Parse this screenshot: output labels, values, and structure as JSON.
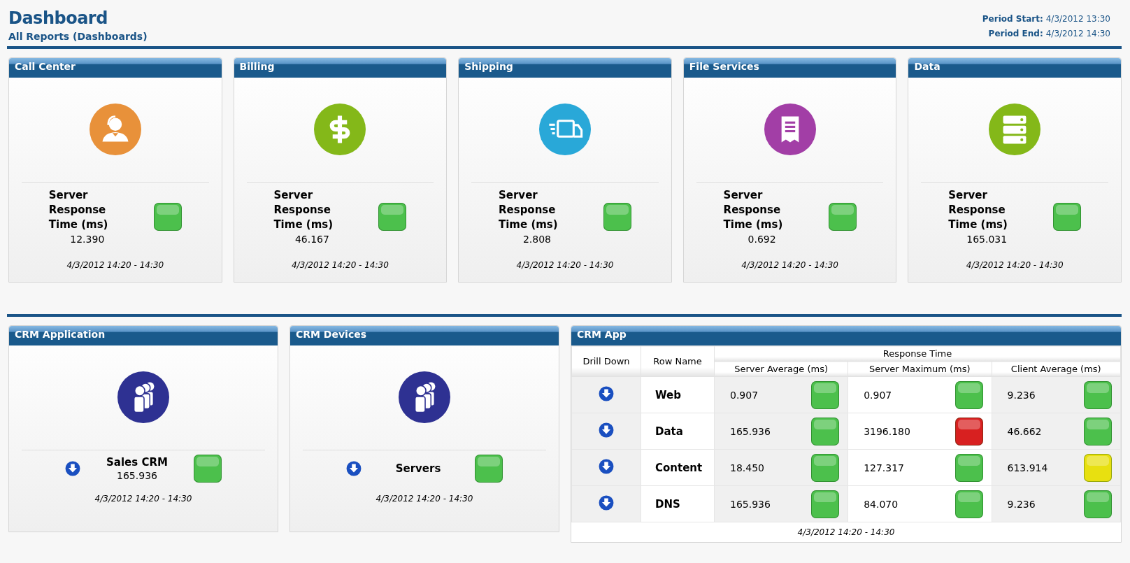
{
  "header": {
    "title": "Dashboard",
    "subtitle": "All Reports (Dashboards)",
    "period": [
      {
        "label": "Period Start:",
        "value": "4/3/2012 13:30"
      },
      {
        "label": "Period End:",
        "value": "4/3/2012 14:30"
      }
    ]
  },
  "top_cards": [
    {
      "title": "Call Center",
      "kind": "headset",
      "color": "#e8913a",
      "metric": "Server Response Time (ms)",
      "value": "12.390",
      "light": {
        "color": "#4cc04c"
      },
      "period": "4/3/2012 14:20 - 14:30"
    },
    {
      "title": "Billing",
      "kind": "dollar",
      "color": "#84b819",
      "metric": "Server Response Time (ms)",
      "value": "46.167",
      "light": {
        "color": "#4cc04c"
      },
      "period": "4/3/2012 14:20 - 14:30"
    },
    {
      "title": "Shipping",
      "kind": "truck",
      "color": "#29a8d8",
      "metric": "Server Response Time (ms)",
      "value": "2.808",
      "light": {
        "color": "#4cc04c"
      },
      "period": "4/3/2012 14:20 - 14:30"
    },
    {
      "title": "File Services",
      "kind": "document",
      "color": "#a23ea6",
      "metric": "Server Response Time (ms)",
      "value": "0.692",
      "light": {
        "color": "#4cc04c"
      },
      "period": "4/3/2012 14:20 - 14:30"
    },
    {
      "title": "Data",
      "kind": "server",
      "color": "#84b819",
      "metric": "Server Response Time (ms)",
      "value": "165.031",
      "light": {
        "color": "#4cc04c"
      },
      "period": "4/3/2012 14:20 - 14:30"
    }
  ],
  "crm_cards": [
    {
      "title": "CRM Application",
      "kind": "people",
      "color": "#2e3192",
      "label": "Sales CRM",
      "value": "165.936",
      "light": {
        "color": "#4cc04c"
      },
      "period": "4/3/2012 14:20 - 14:30"
    },
    {
      "title": "CRM Devices",
      "kind": "people",
      "color": "#2e3192",
      "label": "Servers",
      "light": {
        "color": "#4cc04c"
      },
      "period": "4/3/2012 14:20 - 14:30"
    }
  ],
  "crm_table": {
    "title": "CRM App",
    "columns": {
      "drill": "Drill Down",
      "name": "Row Name",
      "group": "Response Time",
      "values": [
        "Server Average (ms)",
        "Server Maximum (ms)",
        "Client Average (ms)"
      ]
    },
    "rows": [
      {
        "name": "Web",
        "cells": [
          {
            "value": "0.907",
            "color": "#4cc04c"
          },
          {
            "value": "0.907",
            "color": "#4cc04c"
          },
          {
            "value": "9.236",
            "color": "#4cc04c"
          }
        ]
      },
      {
        "name": "Data",
        "cells": [
          {
            "value": "165.936",
            "color": "#4cc04c"
          },
          {
            "value": "3196.180",
            "color": "#d82020"
          },
          {
            "value": "46.662",
            "color": "#4cc04c"
          }
        ]
      },
      {
        "name": "Content",
        "cells": [
          {
            "value": "18.450",
            "color": "#4cc04c"
          },
          {
            "value": "127.317",
            "color": "#4cc04c"
          },
          {
            "value": "613.914",
            "color": "#e8e010"
          }
        ]
      },
      {
        "name": "DNS",
        "cells": [
          {
            "value": "165.936",
            "color": "#4cc04c"
          },
          {
            "value": "84.070",
            "color": "#4cc04c"
          },
          {
            "value": "9.236",
            "color": "#4cc04c"
          }
        ]
      }
    ],
    "period": "4/3/2012 14:20 - 14:30"
  }
}
